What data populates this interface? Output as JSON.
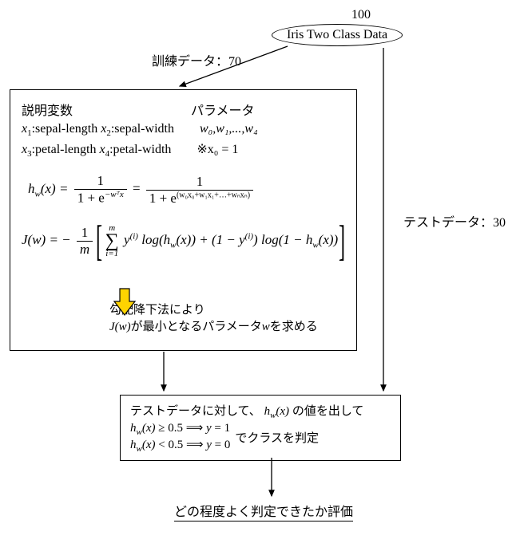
{
  "chart_data": {
    "type": "flowchart",
    "total_samples": 100,
    "train_samples": 70,
    "test_samples": 30,
    "threshold": 0.5
  },
  "top": {
    "count": "100",
    "dataset": "Iris Two Class Data",
    "train_label": "訓練データ：70",
    "test_label": "テストデータ：30"
  },
  "box": {
    "heading_left": "説明変数",
    "heading_right": "パラメータ",
    "x1": "x",
    "x1_sub": "1",
    "x1_desc": ":sepal-length ",
    "x2": "x",
    "x2_sub": "2",
    "x2_desc": ":sepal-width",
    "x3": "x",
    "x3_sub": "3",
    "x3_desc": ":petal-length ",
    "x4": "x",
    "x4_sub": "4",
    "x4_desc": ":petal-width",
    "params": "w₀,w₁,...,w₄",
    "note": "※x₀ = 1",
    "eq1_lhs": "hw(x) = ",
    "eq1_frac1_num": "1",
    "eq1_frac1_den_a": "1 + e",
    "eq1_frac1_den_sup": "−wᵀx",
    "eq1_eq": " = ",
    "eq1_frac2_num": "1",
    "eq1_frac2_den_a": "1 + e",
    "eq1_frac2_den_sup": "(w₀x₀+w₁x₁+…+wₙxₙ)",
    "eq2_lhs": "J(w) =  − ",
    "eq2_frac_num": "1",
    "eq2_frac_den": "m",
    "eq2_sum_top": "m",
    "eq2_sum_bot": "i=1",
    "eq2_body_a": "y",
    "eq2_sup_i": "(i)",
    "eq2_body_b": " log(hw(x)) + ",
    "eq2_body_c": "(1 − y",
    "eq2_body_d": ") log(1 − hw(x))",
    "gd1": "勾配降下法により",
    "gd2": "J(w)が最小となるパラメータwを求める"
  },
  "test": {
    "line1_a": "テストデータに対して、",
    "line1_b": "hw(x)",
    "line1_c": "の値を出して",
    "line2_a": "hw(x) ≥ 0.5 ⟹ y = 1",
    "line3_a": "hw(x) < 0.5 ⟹ y = 0",
    "suffix": "でクラスを判定"
  },
  "eval": "どの程度よく判定できたか評価"
}
